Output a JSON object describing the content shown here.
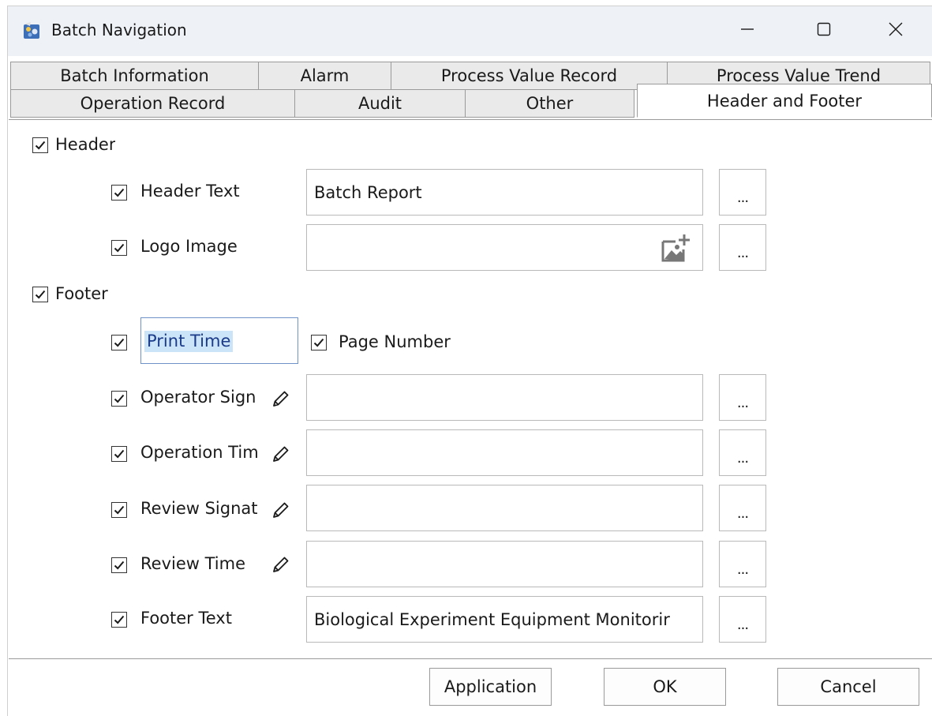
{
  "window": {
    "title": "Batch Navigation",
    "icon": "batch-app-icon",
    "controls": {
      "minimize": "minimize-icon",
      "maximize": "maximize-icon",
      "close": "close-icon"
    }
  },
  "tabs": {
    "row1": [
      "Batch Information",
      "Alarm",
      "Process Value Record",
      "Process Value Trend"
    ],
    "row2": [
      "Operation Record",
      "Audit",
      "Other",
      "Header and Footer"
    ],
    "active": "Header and Footer"
  },
  "header_section": {
    "label": "Header",
    "checked": true,
    "header_text": {
      "label": "Header Text",
      "checked": true,
      "value": "Batch Report",
      "browse": "..."
    },
    "logo_image": {
      "label": "Logo Image",
      "checked": true,
      "value": "",
      "icon": "add-image-icon",
      "browse": "..."
    }
  },
  "footer_section": {
    "label": "Footer",
    "checked": true,
    "print_time": {
      "label": "Print Time",
      "checked": true
    },
    "page_number": {
      "label": "Page Number",
      "checked": true
    },
    "operator_sign": {
      "label": "Operator Sign",
      "checked": true,
      "value": "",
      "browse": "..."
    },
    "operation_time": {
      "label": "Operation Tim",
      "checked": true,
      "value": "",
      "browse": "..."
    },
    "review_signat": {
      "label": "Review Signat",
      "checked": true,
      "value": "",
      "browse": "..."
    },
    "review_time": {
      "label": "Review Time",
      "checked": true,
      "value": "",
      "browse": "..."
    },
    "footer_text": {
      "label": "Footer Text",
      "checked": true,
      "value": "Biological Experiment Equipment Monitorir",
      "browse": "..."
    }
  },
  "buttons": {
    "apply": "Application",
    "ok": "OK",
    "cancel": "Cancel"
  },
  "colors": {
    "titlebar": "#eef2f7",
    "tab_inactive": "#eaeaea",
    "selection": "#cce4f7",
    "focus_border": "#6f93c9"
  }
}
